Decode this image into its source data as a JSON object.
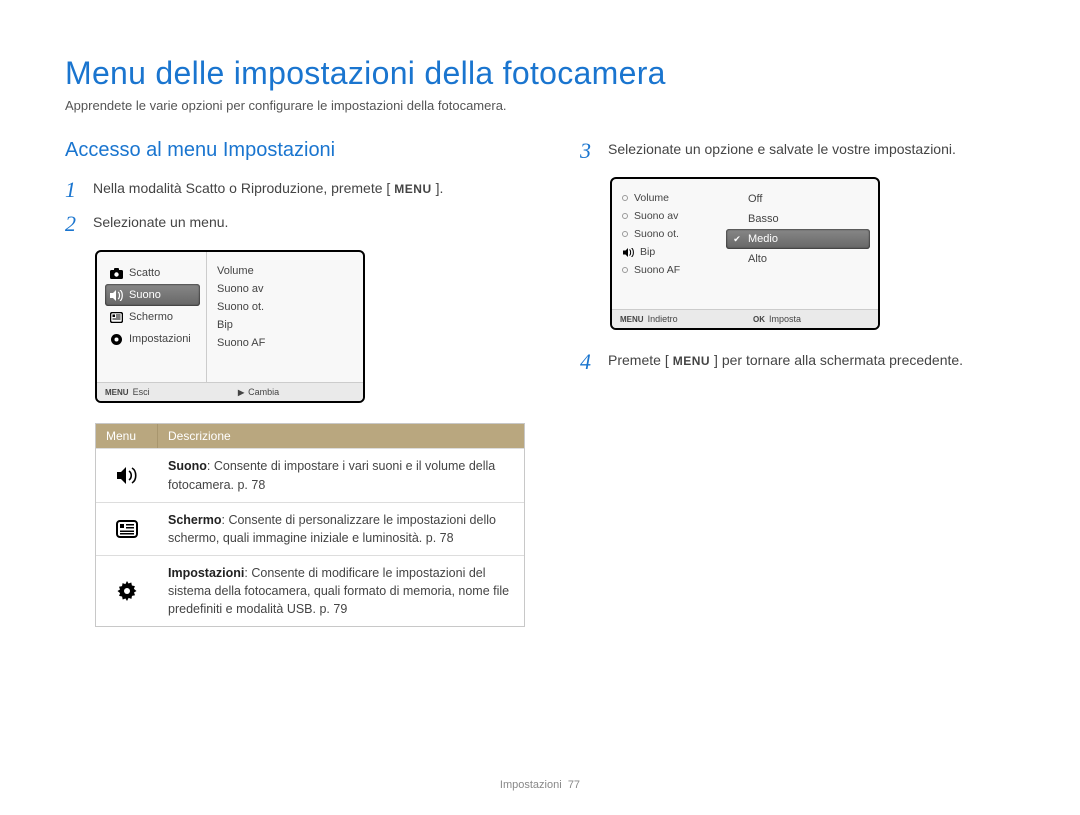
{
  "title": "Menu delle impostazioni della fotocamera",
  "subtitle": "Apprendete le varie opzioni per configurare le impostazioni della fotocamera.",
  "section_heading": "Accesso al menu Impostazioni",
  "steps": {
    "s1_num": "1",
    "s1_text_pre": "Nella modalità Scatto o Riproduzione, premete ",
    "s1_menu": "MENU",
    "s2_num": "2",
    "s2_text": "Selezionate un menu.",
    "s3_num": "3",
    "s3_text": "Selezionate un opzione e salvate le vostre impostazioni.",
    "s4_num": "4",
    "s4_text_pre": "Premete ",
    "s4_menu": "MENU",
    "s4_text_post": " per tornare alla schermata precedente."
  },
  "screen1": {
    "left": [
      "Scatto",
      "Suono",
      "Schermo",
      "Impostazioni"
    ],
    "right": [
      "Volume",
      "Suono av",
      "Suono ot.",
      "Bip",
      "Suono AF"
    ],
    "footer_left_key": "MENU",
    "footer_left_label": "Esci",
    "footer_right_key": "▶",
    "footer_right_label": "Cambia"
  },
  "screen2": {
    "left": [
      "Volume",
      "Suono av",
      "Suono ot.",
      "Bip",
      "Suono AF"
    ],
    "right": [
      "Off",
      "Basso",
      "Medio",
      "Alto"
    ],
    "selected": "Medio",
    "footer_left_key": "MENU",
    "footer_left_label": "Indietro",
    "footer_right_key": "OK",
    "footer_right_label": "Imposta"
  },
  "table": {
    "head_menu": "Menu",
    "head_desc": "Descrizione",
    "rows": [
      {
        "icon": "sound",
        "bold": "Suono",
        "text": ": Consente di impostare i vari suoni e il volume della fotocamera. p. 78"
      },
      {
        "icon": "screen",
        "bold": "Schermo",
        "text": ": Consente di personalizzare le impostazioni dello schermo, quali immagine iniziale e luminosità. p. 78"
      },
      {
        "icon": "gear",
        "bold": "Impostazioni",
        "text": ": Consente di modificare le impostazioni del sistema della fotocamera, quali formato di memoria, nome file predefiniti e modalità USB. p. 79"
      }
    ]
  },
  "footer_section": "Impostazioni",
  "footer_page": "77"
}
